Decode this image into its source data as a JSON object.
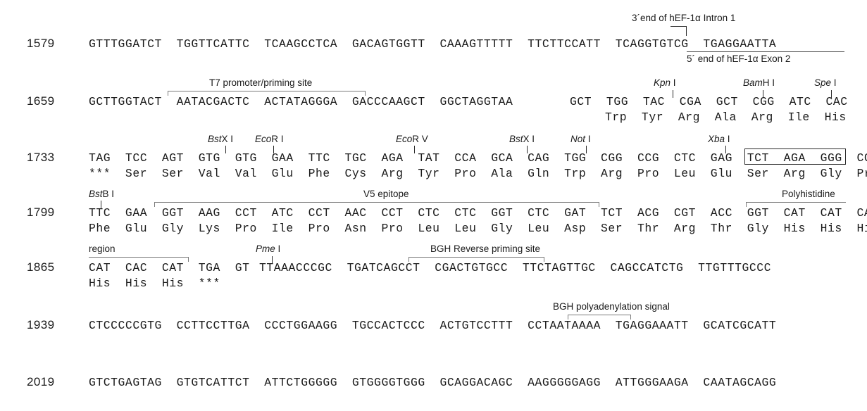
{
  "document": {
    "kind": "plasmid-multiple-cloning-site-sequence-map",
    "background_color": "#ffffff",
    "text_color": "#1a1a1a",
    "rule_color": "#7a7a7a"
  },
  "rows": [
    {
      "position": "1579",
      "dna": "GTTTGGATCT  TGGTTCATTC  TCAAGCCTCA  GACAGTGGTT  CAAAGTTTTT  TTCTTCCATT  TCAGGTGTCG  TGAGGAATTA",
      "protein": ""
    },
    {
      "position": "1659",
      "dna_blocks": "GCTTGGTACT  AATACGACTC  ACTATAGGGA  GACCCAAGCT  GGCTAGGTAA",
      "dna_codons": "GCT  TGG  TAC  CGA  GCT  CGG  ATC  CAC",
      "protein_codons": "Trp  Tyr  Arg  Ala  Arg  Ile  His"
    },
    {
      "position": "1733",
      "dna_codons": "TAG  TCC  AGT  GTG  GTG  GAA  TTC  TGC  AGA  TAT  CCA  GCA  CAG  TGG  CGG  CCG  CTC  GAG  TCT  AGA  GGG  CCC",
      "protein_codons": "***  Ser  Ser  Val  Val  Glu  Phe  Cys  Arg  Tyr  Pro  Ala  Gln  Trp  Arg  Pro  Leu  Glu  Ser  Arg  Gly  Pro"
    },
    {
      "position": "1799",
      "dna_codons": "TTC  GAA  GGT  AAG  CCT  ATC  CCT  AAC  CCT  CTC  CTC  GGT  CTC  GAT  TCT  ACG  CGT  ACC  GGT  CAT  CAT  CAC",
      "protein_codons": "Phe  Glu  Gly  Lys  Pro  Ile  Pro  Asn  Pro  Leu  Leu  Gly  Leu  Asp  Ser  Thr  Arg  Thr  Gly  His  His  His"
    },
    {
      "position": "1865",
      "dna_codons": "CAT  CAC  CAT  TGA  GT",
      "protein_codons": "His  His  His  ***",
      "dna_blocks": "TTAAACCCGC  TGATCAGCCT  CGACTGTGCC  TTCTAGTTGC  CAGCCATCTG  TTGTTTGCCC"
    },
    {
      "position": "1939",
      "dna": "CTCCCCCGTG  CCTTCCTTGA  CCCTGGAAGG  TGCCACTCCC  ACTGTCCTTT  CCTAATAAAA  TGAGGAAATT  GCATCGCATT",
      "protein": ""
    },
    {
      "position": "2019",
      "dna": "GTCTGAGTAG  GTGTCATTCT  ATTCTGGGGG  GTGGGGTGGG  GCAGGACAGC  AAGGGGGAGG  ATTGGGAAGA  CAATAGCAGG",
      "protein": ""
    }
  ],
  "annotations": {
    "hef1a_intron1": "3´end of hEF-1α Intron 1",
    "hef1a_exon2": "5´ end of hEF-1α Exon 2",
    "t7_promoter": "T7 promoter/priming site",
    "v5_epitope": "V5 epitope",
    "polyhistidine": "Polyhistidine",
    "region": "region",
    "bgh_reverse": "BGH Reverse priming site",
    "bgh_polya": "BGH polyadenylation signal"
  },
  "restriction_sites": {
    "kpn1": {
      "italic": "Kpn",
      "rest": " I"
    },
    "bamh1": {
      "italic": "Bam",
      "rest": "H I"
    },
    "spe1": {
      "italic": "Spe",
      "rest": " I"
    },
    "bstx1_a": {
      "italic": "Bst",
      "rest": "X I"
    },
    "ecor1": {
      "italic": "Eco",
      "rest": "R I"
    },
    "ecorv": {
      "italic": "Eco",
      "rest": "R V"
    },
    "bstx1_b": {
      "italic": "Bst",
      "rest": "X I"
    },
    "not1": {
      "italic": "Not",
      "rest": " I"
    },
    "xba1": {
      "italic": "Xba",
      "rest": " I"
    },
    "bstb1": {
      "italic": "Bst",
      "rest": "B I"
    },
    "pme1": {
      "italic": "Pme",
      "rest": " I"
    }
  }
}
